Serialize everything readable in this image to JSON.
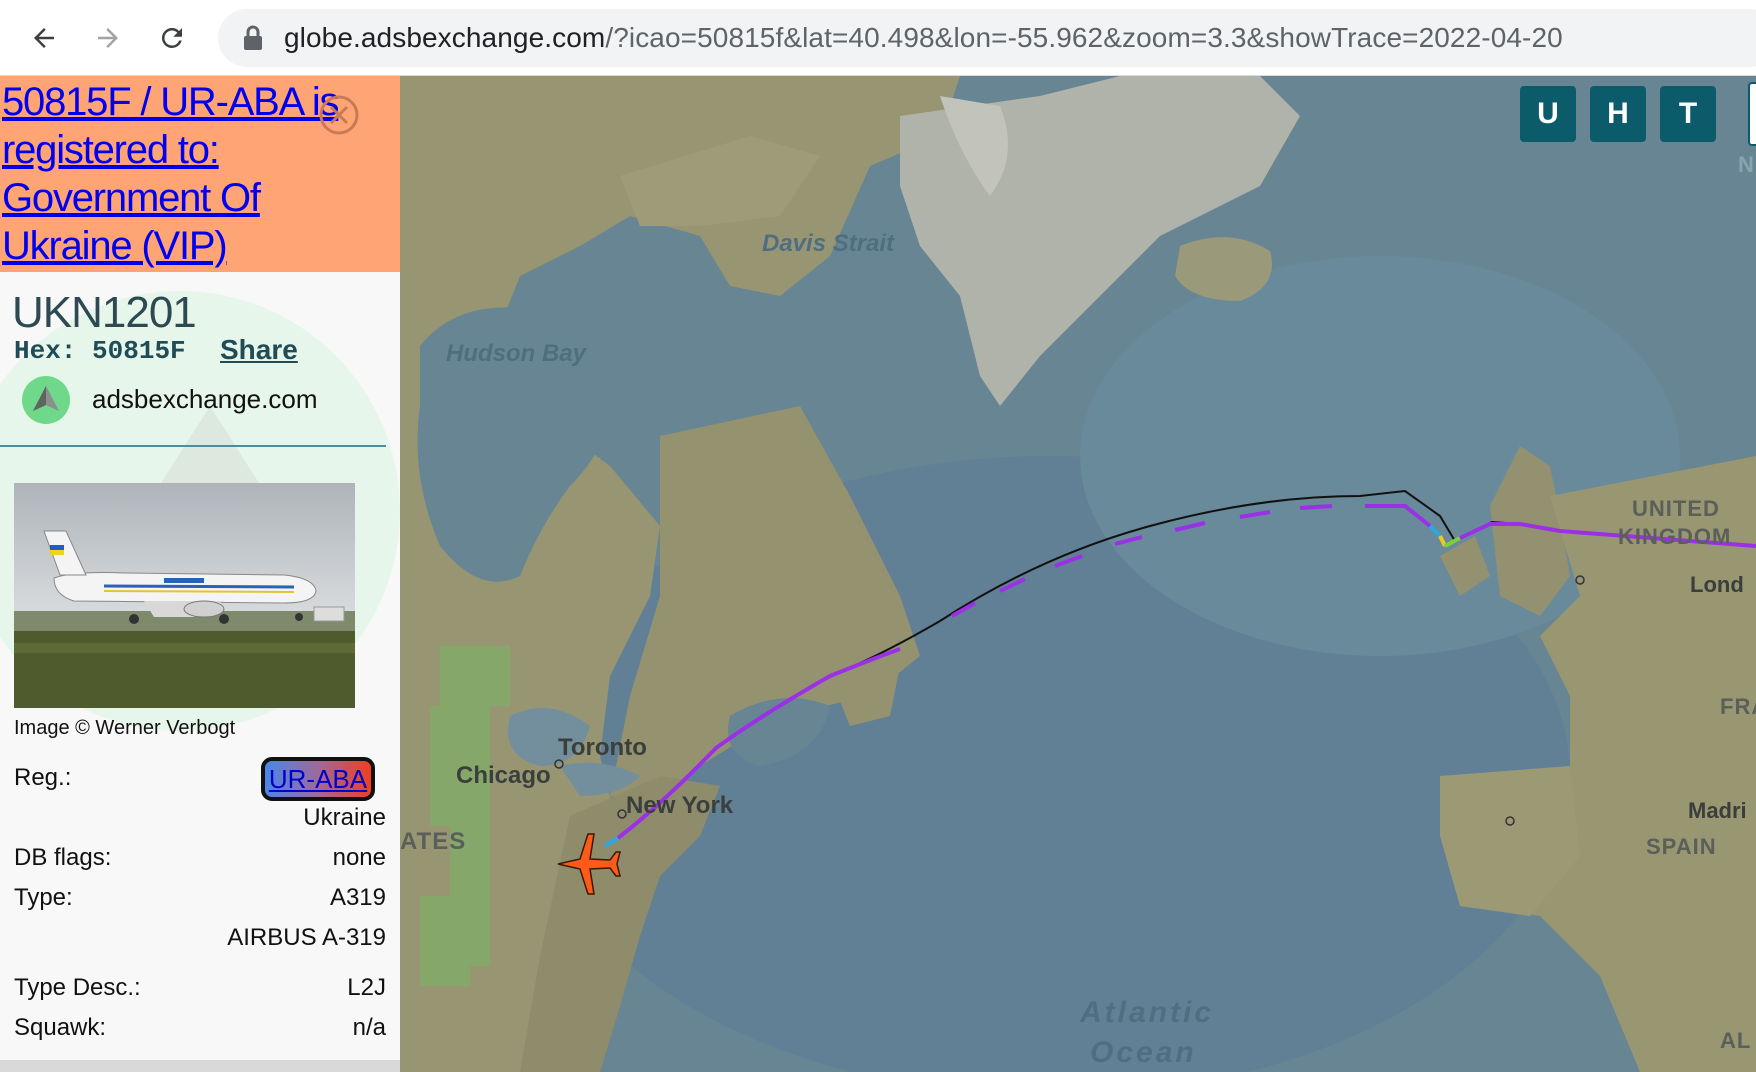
{
  "browser": {
    "url_host": "globe.adsbexchange.com",
    "url_rest": "/?icao=50815f&lat=40.498&lon=-55.962&zoom=3.3&showTrace=2022-04-20",
    "icons": [
      "back-arrow-icon",
      "forward-arrow-icon",
      "reload-icon",
      "lock-icon"
    ]
  },
  "sidebar": {
    "registration_banner": "50815F / UR-ABA is registered to: Government Of Ukraine (VIP)",
    "callsign": "UKN1201",
    "hex_label": "Hex:",
    "hex_value": "50815F",
    "share_label": "Share",
    "source": "adsbexchange.com",
    "photo_credit": "Image © Werner Verbogt",
    "info": {
      "reg_label": "Reg.:",
      "reg_value": "UR-ABA",
      "country": "Ukraine",
      "db_flags_label": "DB flags:",
      "db_flags_value": "none",
      "type_label": "Type:",
      "type_value": "A319",
      "type_full": "AIRBUS A-319",
      "type_desc_label": "Type Desc.:",
      "type_desc_value": "L2J",
      "squawk_label": "Squawk:",
      "squawk_value": "n/a"
    },
    "colors": {
      "banner": "#ffa474",
      "accent": "#1f4c57"
    }
  },
  "map": {
    "buttons": [
      "U",
      "H",
      "T"
    ],
    "labels": {
      "davis_strait": "Davis Strait",
      "hudson_bay": "Hudson Bay",
      "toronto": "Toronto",
      "chicago": "Chicago",
      "new_york": "New York",
      "united": "UNITED",
      "kingdom": "KINGDOM",
      "london": "Lond",
      "france": "FRA",
      "madrid": "Madri",
      "spain": "SPAIN",
      "states": "ATES",
      "atlantic": "Atlantic",
      "ocean": "Ocean",
      "algeria": "AL",
      "north_edge": "N"
    },
    "colors": {
      "trace": "#9b30e6",
      "aircraft": "#ff5a1a",
      "button": "#0b5b6a"
    }
  }
}
